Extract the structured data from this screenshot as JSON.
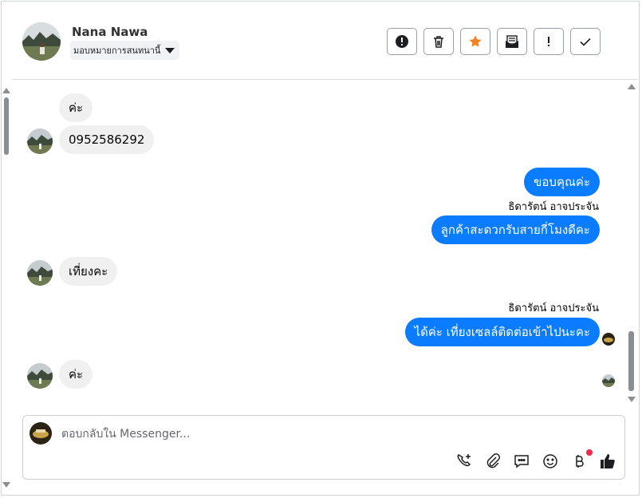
{
  "header": {
    "contact_name": "Nana Nawa",
    "assign_label": "มอบหมายการสนทนานี้",
    "actions": [
      {
        "name": "spam-button",
        "icon": "alert-circle-icon"
      },
      {
        "name": "delete-button",
        "icon": "trash-icon"
      },
      {
        "name": "star-button",
        "icon": "star-icon",
        "color": "#f5821f"
      },
      {
        "name": "mark-unread-button",
        "icon": "envelope-icon"
      },
      {
        "name": "flag-button",
        "icon": "exclamation-icon"
      },
      {
        "name": "done-button",
        "icon": "checkmark-icon"
      }
    ]
  },
  "messages": {
    "m1": "ค่ะ",
    "m2": "0952586292",
    "m3": "ขอบคุณค่ะ",
    "sender1": "ธิดารัตน์ อาจประจัน",
    "m4": "ลูกค้าสะดวกรับสายกี่โมงดีคะ",
    "m5": "เที่ยงคะ",
    "sender2": "ธิดารัตน์ อาจประจัน",
    "m6": "ได้ค่ะ เที่ยงเซลล์ติดต่อเข้าไปนะคะ",
    "m7": "ค่ะ"
  },
  "composer": {
    "placeholder": "ตอบกลับใน Messenger...",
    "tools": [
      "add-call-icon",
      "paperclip-icon",
      "saved-reply-icon",
      "emoji-icon",
      "currency-icon",
      "thumbs-up-icon"
    ]
  },
  "colors": {
    "outgoing": "#0a7cff",
    "incoming": "#f0f0f0",
    "star": "#f5821f",
    "notification": "#f02849"
  }
}
